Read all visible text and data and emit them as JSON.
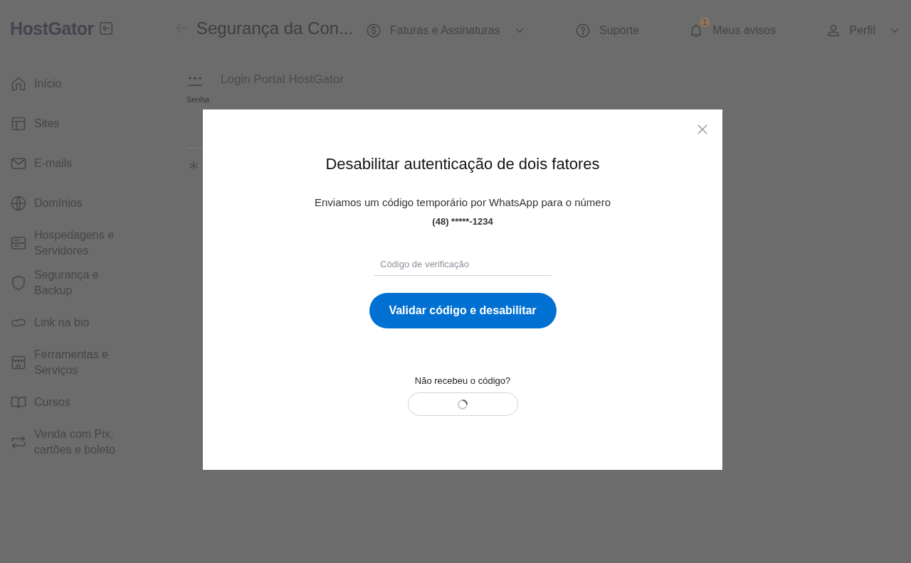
{
  "header": {
    "logo": "HostGator",
    "page_title": "Segurança da Con...",
    "nav": [
      {
        "kind": "billing",
        "label": "Faturas e Assinaturas",
        "dropdown": true
      },
      {
        "kind": "help",
        "label": "Suporte",
        "dropdown": false
      },
      {
        "kind": "bell",
        "label": "Meus avisos",
        "badge": "1",
        "dropdown": false
      },
      {
        "kind": "user",
        "label": "Perfil",
        "dropdown": true
      }
    ]
  },
  "sidebar": {
    "items": [
      {
        "kind": "home",
        "label": "Início"
      },
      {
        "kind": "layout",
        "label": "Sites"
      },
      {
        "kind": "mail",
        "label": "E-mails"
      },
      {
        "kind": "globe",
        "label": "Domínios"
      },
      {
        "kind": "server",
        "label": "Hospedagens e Servidores"
      },
      {
        "kind": "shield",
        "label": "Segurança e Backup"
      },
      {
        "kind": "link",
        "label": "Link na bio"
      },
      {
        "kind": "store",
        "label": "Ferramentas e Serviços"
      },
      {
        "kind": "book",
        "label": "Cursos"
      },
      {
        "kind": "exchange",
        "label": "Venda com Pix, cartões e boleto"
      }
    ]
  },
  "content": {
    "section_title": "Login Portal HostGator",
    "field_label": "Senha"
  },
  "modal": {
    "title": "Desabilitar autenticação de dois fatores",
    "message": "Enviamos um código temporário por WhatsApp para o número",
    "phone": "(48) *****-1234",
    "code_field": {
      "placeholder": "Código de verificação"
    },
    "submit_button": "Validar código e desabilitar",
    "resend_prompt": "Não recebeu o código?",
    "resend_button": {
      "loading": true
    }
  }
}
